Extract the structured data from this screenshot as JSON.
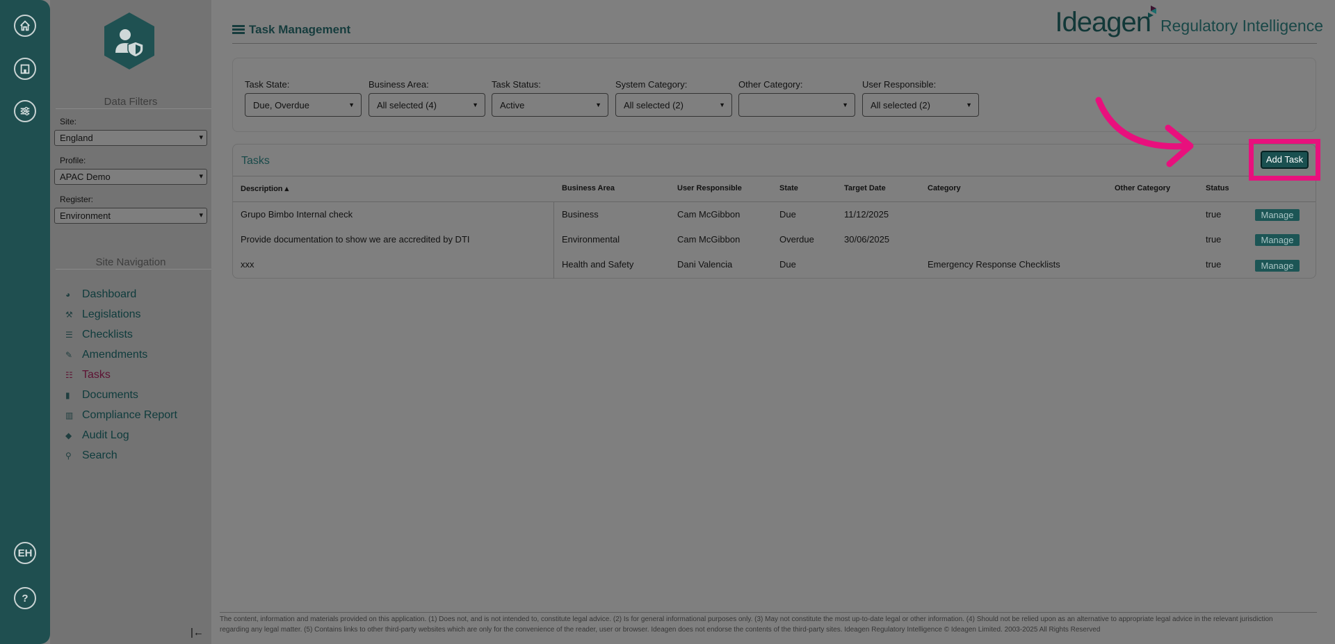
{
  "rail": {
    "user_initials": "EH",
    "help_label": "?"
  },
  "sidebar": {
    "data_filters_title": "Data Filters",
    "site_label": "Site:",
    "site_value": "England",
    "profile_label": "Profile:",
    "profile_value": "APAC Demo",
    "register_label": "Register:",
    "register_value": "Environment",
    "site_nav_title": "Site Navigation",
    "nav": [
      {
        "label": "Dashboard",
        "icon": "dashboard-icon"
      },
      {
        "label": "Legislations",
        "icon": "gavel-icon"
      },
      {
        "label": "Checklists",
        "icon": "list-icon"
      },
      {
        "label": "Amendments",
        "icon": "edit-icon"
      },
      {
        "label": "Tasks",
        "icon": "tasks-icon",
        "active": true
      },
      {
        "label": "Documents",
        "icon": "document-icon"
      },
      {
        "label": "Compliance Report",
        "icon": "bar-chart-icon"
      },
      {
        "label": "Audit Log",
        "icon": "tags-icon"
      },
      {
        "label": "Search",
        "icon": "search-icon"
      }
    ]
  },
  "header": {
    "title": "Task Management",
    "brand_name": "Ideagen",
    "brand_sub": "Regulatory Intelligence"
  },
  "filters": [
    {
      "label": "Task State:",
      "value": "Due, Overdue"
    },
    {
      "label": "Business Area:",
      "value": "All selected (4)"
    },
    {
      "label": "Task Status:",
      "value": "Active"
    },
    {
      "label": "System Category:",
      "value": "All selected (2)"
    },
    {
      "label": "Other Category:",
      "value": ""
    },
    {
      "label": "User Responsible:",
      "value": "All selected (2)"
    }
  ],
  "tasks": {
    "title": "Tasks",
    "add_button": "Add Task",
    "columns": [
      "Description ▴",
      "Business Area",
      "User Responsible",
      "State",
      "Target Date",
      "Category",
      "Other Category",
      "Status"
    ],
    "rows": [
      {
        "description": "Grupo Bimbo Internal check",
        "business_area": "Business",
        "user": "Cam McGibbon",
        "state": "Due",
        "target_date": "11/12/2025",
        "category": "",
        "other_category": "",
        "status": "true",
        "action": "Manage"
      },
      {
        "description": "Provide documentation to show we are accredited by DTI",
        "business_area": "Environmental",
        "user": "Cam McGibbon",
        "state": "Overdue",
        "target_date": "30/06/2025",
        "category": "",
        "other_category": "",
        "status": "true",
        "action": "Manage"
      },
      {
        "description": "xxx",
        "business_area": "Health and Safety",
        "user": "Dani Valencia",
        "state": "Due",
        "target_date": "",
        "category": "Emergency Response Checklists",
        "other_category": "",
        "status": "true",
        "action": "Manage"
      }
    ]
  },
  "footer": {
    "text": "The content, information and materials provided on this application. (1) Does not, and is not intended to, constitute legal advice. (2) Is for general informational purposes only. (3) May not constitute the most up-to-date legal or other information. (4) Should not be relied upon as an alternative to appropriate legal advice in the relevant jurisdiction regarding any legal matter. (5) Contains links to other third-party websites which are only for the convenience of the reader, user or browser. Ideagen does not endorse the contents of the third-party sites. Ideagen Regulatory Intelligence © Ideagen Limited. 2003-2025 All Rights Reserved"
  },
  "colors": {
    "highlight": "#e8107d",
    "brand_teal": "#1f4f50"
  }
}
